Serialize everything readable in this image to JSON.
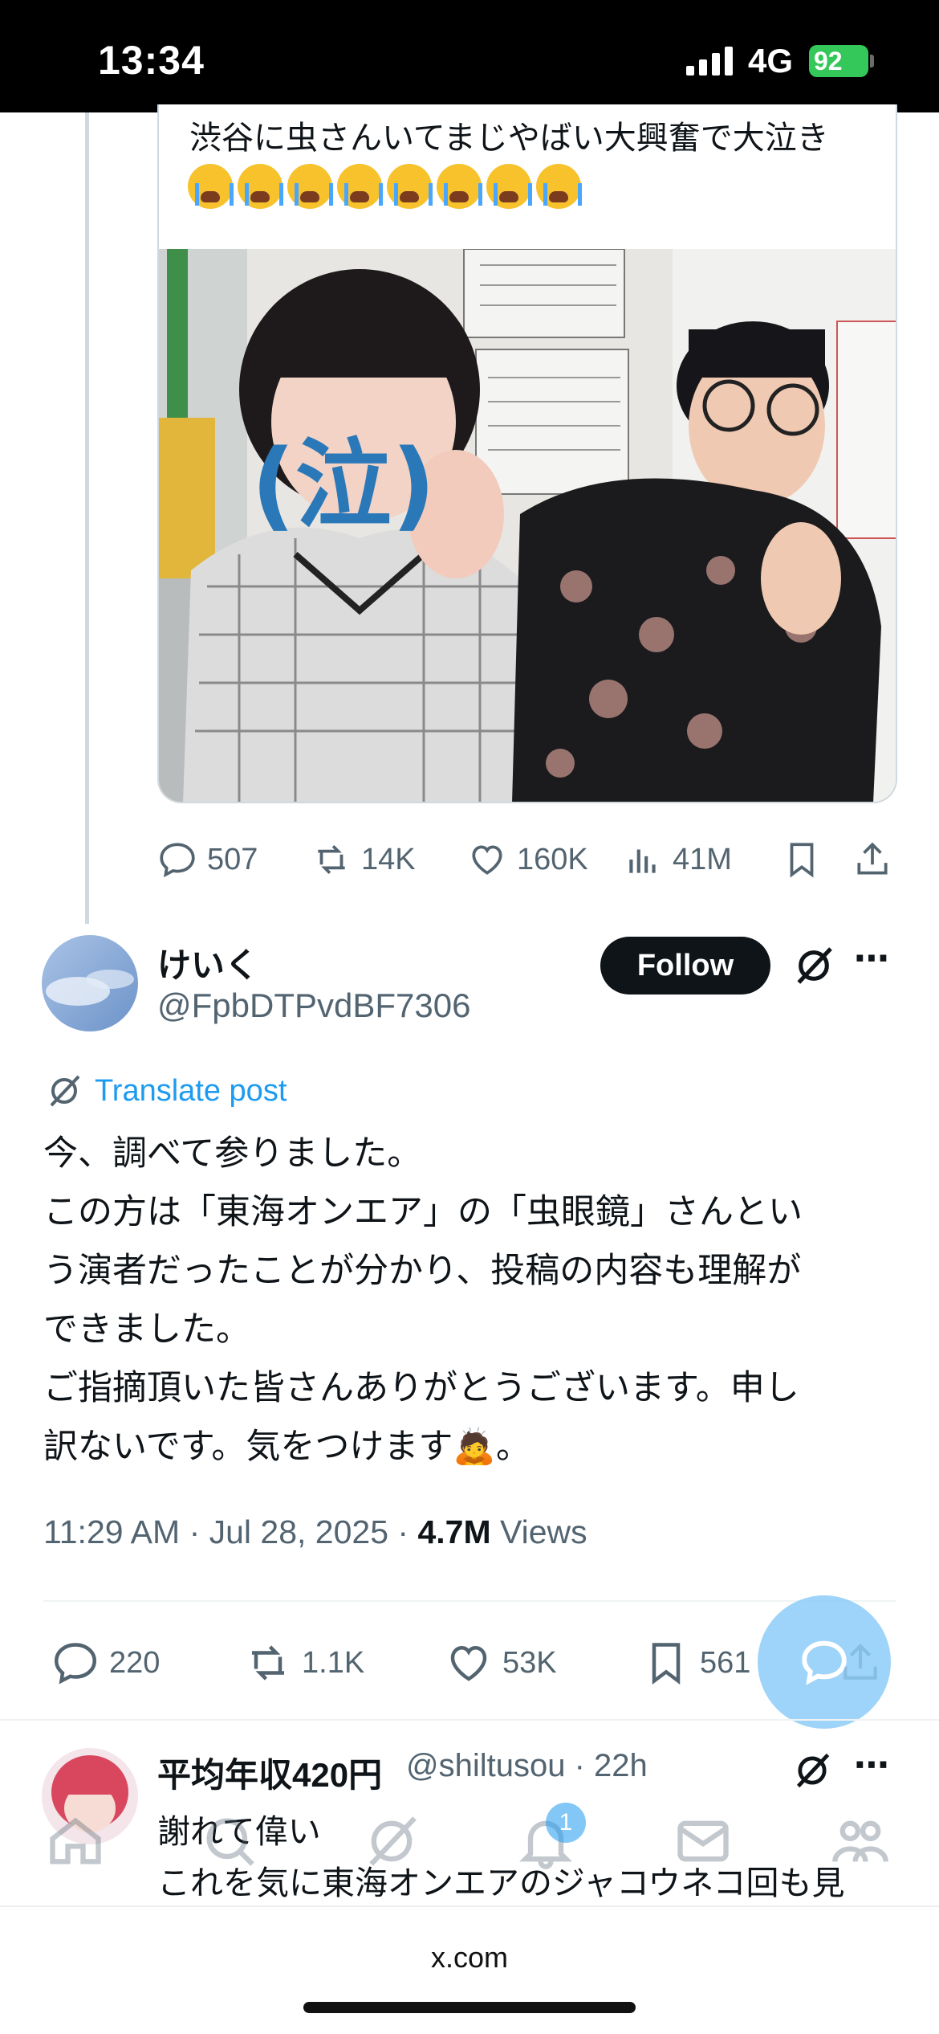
{
  "status_bar": {
    "time": "13:34",
    "network": "4G",
    "battery": "92"
  },
  "quoted_post": {
    "text": "渋谷に虫さんいてまじやばい大興奮で大泣き",
    "emoji_name": "loudly-crying-face",
    "emoji_count": 8,
    "photo_overlay_text": "(泣)",
    "actions": {
      "replies": "507",
      "reposts": "14K",
      "likes": "160K",
      "views": "41M"
    }
  },
  "reply": {
    "display_name": "けいく",
    "handle": "@FpbDTPvdBF7306",
    "follow_label": "Follow",
    "translate_label": "Translate post",
    "body": "今、調べて参りました。\nこの方は「東海オンエア」の「虫眼鏡」さんとい\nう演者だったことが分かり、投稿の内容も理解が\nできました。\nご指摘頂いた皆さんありがとうございます。申し\n訳ないです。気をつけます🙇。",
    "time": "11:29 AM · Jul 28, 2025 · ",
    "views_count": "4.7M",
    "views_label": " Views",
    "actions": {
      "replies": "220",
      "reposts": "1.1K",
      "likes": "53K",
      "bookmarks": "561"
    }
  },
  "next_reply": {
    "display_name": "平均年収420円",
    "handle_time": "@shiltusou · 22h",
    "line1": "謝れて偉い",
    "line2": "これを気に東海オンエアのジャコウネコ回も見"
  },
  "tab_bar": {
    "notifications_badge": "1"
  },
  "browser": {
    "url": "x.com"
  },
  "colors": {
    "accent": "#1d9bf0",
    "text": "#0f1419",
    "muted": "#536471",
    "battery": "#34c759"
  }
}
